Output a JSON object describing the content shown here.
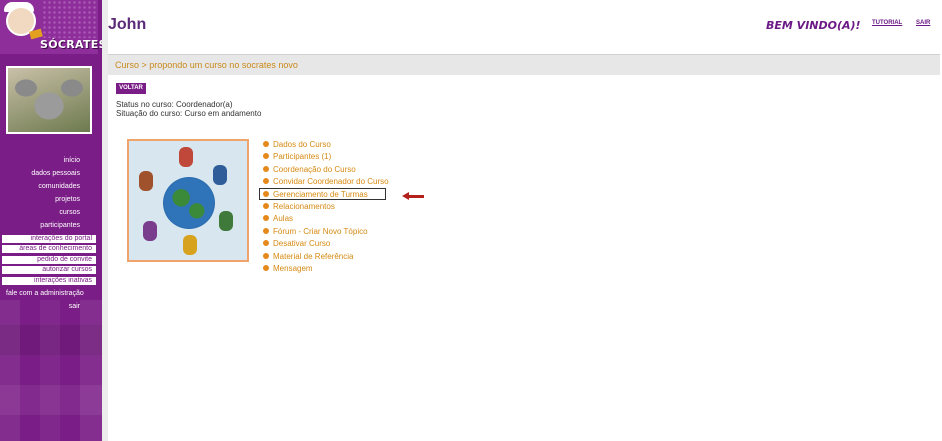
{
  "logo": {
    "text": "SÓCRATES"
  },
  "sidebar": {
    "items": [
      {
        "label": "início",
        "style": "plain"
      },
      {
        "label": "dados pessoais",
        "style": "plain"
      },
      {
        "label": "comunidades",
        "style": "plain"
      },
      {
        "label": "projetos",
        "style": "plain"
      },
      {
        "label": "cursos",
        "style": "plain"
      },
      {
        "label": "participantes",
        "style": "plain"
      },
      {
        "label": "interações do portal",
        "style": "boxed"
      },
      {
        "label": "áreas de conhecimento",
        "style": "boxed"
      },
      {
        "label": "pedido de convite",
        "style": "boxed"
      },
      {
        "label": "autorizar cursos",
        "style": "boxed"
      },
      {
        "label": "interações inativas",
        "style": "boxed"
      },
      {
        "label": "fale com a administração",
        "style": "wide"
      },
      {
        "label": "sair",
        "style": "plain"
      }
    ]
  },
  "header": {
    "username": "John",
    "welcome": "BEM VINDO(A)!",
    "links": {
      "tutorial": "TUTORIAL",
      "sair": "SAIR"
    }
  },
  "breadcrumb": "Curso > propondo um curso no socrates novo",
  "voltar_label": "VOLTAR",
  "status": {
    "line1": "Status no curso: Coordenador(a)",
    "line2": "Situação do curso: Curso em andamento"
  },
  "course_menu": {
    "items": [
      "Dados do Curso",
      "Participantes (1)",
      "Coordenação do Curso",
      "Convidar Coordenador do Curso",
      "Gerenciamento de Turmas",
      "Relacionamentos",
      "Aulas",
      "Fórum - Criar Novo Tópico",
      "Desativar Curso",
      "Material de Referência",
      "Mensagem"
    ],
    "highlighted": "Gerenciamento de Turmas"
  },
  "colors": {
    "sidebar": "#7a1d86",
    "link_orange": "#d68a12",
    "arrow_red": "#b4201a"
  }
}
